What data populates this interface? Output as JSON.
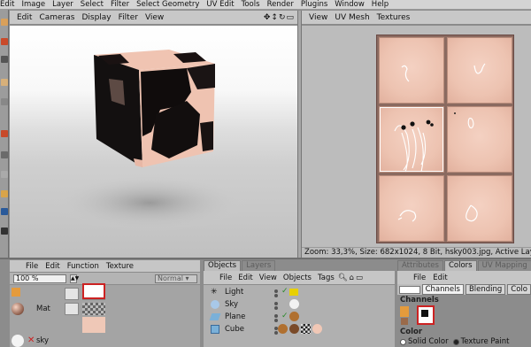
{
  "menubar": [
    "Edit",
    "Image",
    "Layer",
    "Select",
    "Filter",
    "Select Geometry",
    "UV Edit",
    "Tools",
    "Render",
    "Plugins",
    "Window",
    "Help"
  ],
  "viewport": {
    "menu": [
      "Edit",
      "Cameras",
      "Display",
      "Filter",
      "View"
    ],
    "nav_icons": [
      "move-icon",
      "zoom-icon",
      "rotate-icon",
      "maximize-icon"
    ]
  },
  "uv_editor": {
    "menu": [
      "View",
      "UV Mesh",
      "Textures"
    ],
    "status": "Zoom: 33,3%, Size: 682x1024, 8 Bit, hsky003.jpg, Active Layer: Lay"
  },
  "material_panel": {
    "menu": [
      "File",
      "Edit",
      "Function",
      "Texture"
    ],
    "zoom_value": "100 %",
    "mode_value": "Normal",
    "materials": [
      {
        "name": "Mat"
      },
      {
        "name": "sky"
      }
    ]
  },
  "objects_panel": {
    "tabs": [
      "Objects",
      "Layers"
    ],
    "menu": [
      "File",
      "Edit",
      "View",
      "Objects",
      "Tags"
    ],
    "items": [
      {
        "name": "Light"
      },
      {
        "name": "Sky"
      },
      {
        "name": "Plane"
      },
      {
        "name": "Cube"
      }
    ]
  },
  "attributes_panel": {
    "tabs": [
      "Attributes",
      "Colors",
      "UV Mapping"
    ],
    "menu": [
      "File",
      "Edit"
    ],
    "subtabs": [
      "Channels",
      "Blending",
      "Colo"
    ],
    "channels_label": "Channels",
    "color_label": "Color",
    "radio": [
      "Solid Color",
      "Texture Paint"
    ]
  },
  "colors": {
    "accent_red": "#cc2222",
    "skin": "#f1c8b6",
    "checker_yellow": "#e8d000"
  }
}
